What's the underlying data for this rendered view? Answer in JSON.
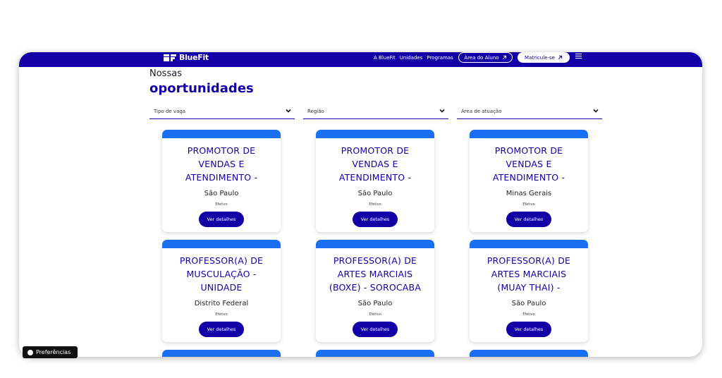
{
  "header": {
    "logo_text": "BlueFit",
    "nav": [
      "A BlueFit",
      "Unidades",
      "Programas"
    ],
    "area_aluno": "Área do Aluno",
    "matricule": "Matricule-se",
    "brand_color": "#1200a6"
  },
  "page": {
    "heading_small": "Nossas",
    "heading_big": "oportunidades"
  },
  "filters": [
    {
      "label": "Tipo de vaga"
    },
    {
      "label": "Região"
    },
    {
      "label": "Área de atuação"
    }
  ],
  "cards": [
    {
      "title": "PROMOTOR DE VENDAS E ATENDIMENTO -",
      "location": "São Paulo",
      "type": "Efetivo",
      "button": "Ver detalhes"
    },
    {
      "title": "PROMOTOR DE VENDAS E ATENDIMENTO -",
      "location": "São Paulo",
      "type": "Efetivo",
      "button": "Ver detalhes"
    },
    {
      "title": "PROMOTOR DE VENDAS E ATENDIMENTO -",
      "location": "Minas Gerais",
      "type": "Efetivo",
      "button": "Ver detalhes"
    },
    {
      "title": "PROFESSOR(A) DE MUSCULAÇÃO - UNIDADE",
      "location": "Distrito Federal",
      "type": "Efetivo",
      "button": "Ver detalhes"
    },
    {
      "title": "PROFESSOR(A) DE ARTES MARCIAIS (BOXE) - SOROCABA",
      "location": "São Paulo",
      "type": "Efetivo",
      "button": "Ver detalhes"
    },
    {
      "title": "PROFESSOR(A) DE ARTES MARCIAIS (MUAY THAI) -",
      "location": "São Paulo",
      "type": "Efetivo",
      "button": "Ver detalhes"
    }
  ],
  "cookie": {
    "label": "Preferências"
  },
  "colors": {
    "stripe": "#1a6ff0",
    "button": "#1200a6"
  }
}
